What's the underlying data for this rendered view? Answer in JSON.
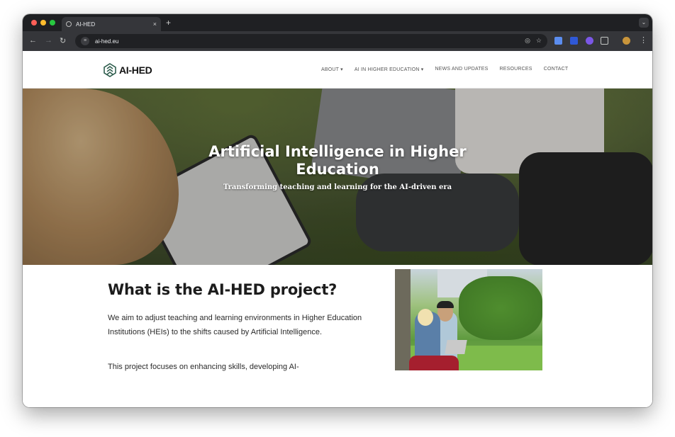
{
  "browser": {
    "tab_title": "AI-HED",
    "tab_close": "×",
    "new_tab": "+",
    "tab_menu": "⌄",
    "back": "←",
    "forward": "→",
    "reload": "↻",
    "url": "ai-hed.eu",
    "omnibox_icons": [
      "eye-off-icon",
      "star-icon"
    ],
    "menu": "⋮"
  },
  "header": {
    "logo_text": "AI-HED",
    "nav": [
      {
        "label": "ABOUT ▾"
      },
      {
        "label": "AI IN HIGHER EDUCATION ▾"
      },
      {
        "label": "NEWS AND UPDATES"
      },
      {
        "label": "RESOURCES"
      },
      {
        "label": "CONTACT"
      }
    ]
  },
  "hero": {
    "title": "Artificial Intelligence in Higher Education",
    "subtitle": "Transforming teaching and learning for the AI-driven era"
  },
  "about": {
    "title": "What is the AI-HED project?",
    "para1": "We aim to adjust teaching and learning environments in Higher Education Institutions (HEIs) to the shifts caused by Artificial Intelligence.",
    "para2": "This project focuses on enhancing skills, developing AI-"
  },
  "colors": {
    "accent_logo": "#2f5e4e",
    "chrome_dark": "#1f2023",
    "text": "#1c1c1c"
  }
}
